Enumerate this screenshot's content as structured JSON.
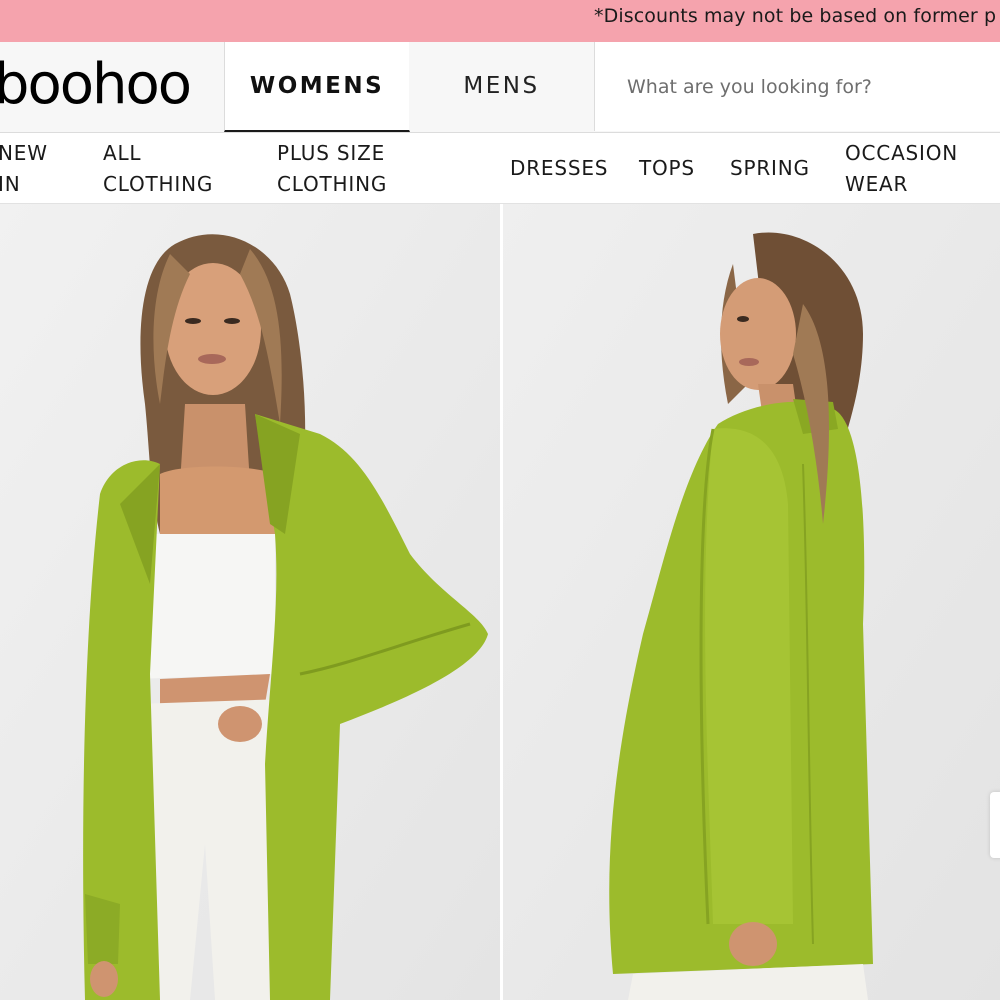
{
  "promo_banner": {
    "text": "*Discounts may not be based on former p",
    "color": "#f5a3ad"
  },
  "header": {
    "logo_text": "boohoo",
    "tabs": [
      {
        "label": "WOMENS",
        "selected": true
      },
      {
        "label": "MENS",
        "selected": false
      }
    ],
    "search": {
      "placeholder": "What are you looking for?",
      "value": ""
    }
  },
  "category_nav": {
    "items": [
      {
        "line1": "NEW",
        "line2": "IN"
      },
      {
        "line1": "ALL",
        "line2": "CLOTHING"
      },
      {
        "line1": "PLUS SIZE",
        "line2": "CLOTHING"
      },
      {
        "line1": "DRESSES",
        "line2": ""
      },
      {
        "line1": "TOPS",
        "line2": ""
      },
      {
        "line1": "SPRING",
        "line2": ""
      },
      {
        "line1": "OCCASION",
        "line2": "WEAR"
      }
    ]
  },
  "product_images": [
    {
      "view": "front",
      "garment_color": "#9cbb2c"
    },
    {
      "view": "back",
      "garment_color": "#9cbb2c"
    }
  ],
  "colors": {
    "accent_pink": "#f5a3ad",
    "blazer_green": "#9cbb2c",
    "photo_background": "#ececec"
  }
}
